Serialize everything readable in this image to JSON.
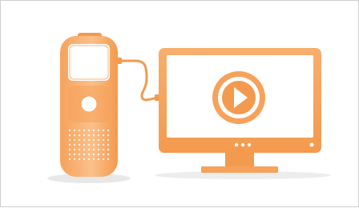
{
  "illustration": {
    "device_icon": "voice-recorder-icon",
    "monitor_icon": "monitor-icon",
    "play_icon": "play-icon",
    "cable_icon": "usb-cable-icon",
    "colors": {
      "orange": "#F6A25B",
      "orange_dark": "#F08A36",
      "orange_light": "#FBC08A",
      "screen_bg": "#FFFFFF",
      "frame_border": "#CFCFCF",
      "shadow": "#E6E6E6"
    }
  }
}
